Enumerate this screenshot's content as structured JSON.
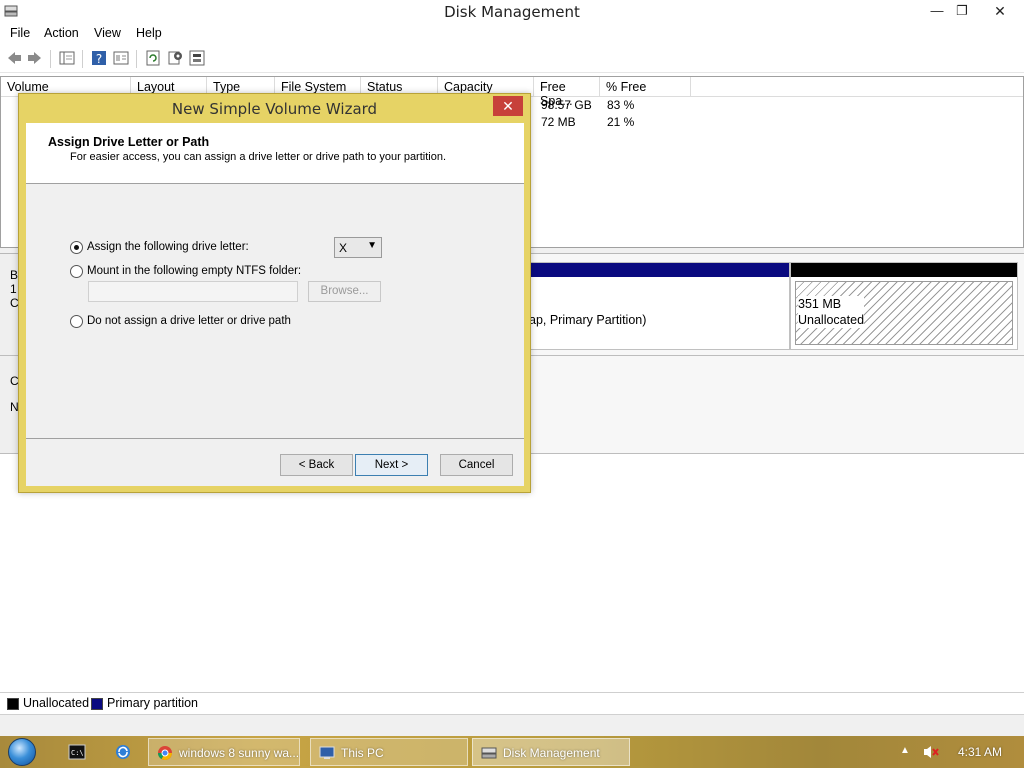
{
  "window": {
    "title": "Disk Management",
    "minimize_glyph": "—",
    "maximize_glyph": "❐",
    "close_glyph": "✕"
  },
  "menubar": {
    "items": [
      "File",
      "Action",
      "View",
      "Help"
    ]
  },
  "toolbar": {
    "icons": [
      "back-icon",
      "forward-icon",
      "console-tree-icon",
      "help-icon",
      "properties-icon",
      "refresh-icon",
      "settings-icon",
      "disk-properties-icon"
    ]
  },
  "volume_list": {
    "columns": [
      "Volume",
      "Layout",
      "Type",
      "File System",
      "Status",
      "Capacity",
      "Free Spa...",
      "% Free"
    ],
    "rows": [
      {
        "free": "98.57 GB",
        "pct": "83 %"
      },
      {
        "free": "72 MB",
        "pct": "21 %"
      }
    ]
  },
  "disk_view": {
    "disk0_label_fragments": [
      "B",
      "1",
      "C"
    ],
    "disk1_label_fragments": [
      "C",
      "N"
    ],
    "primary_partition_text": "ap, Primary Partition)",
    "unallocated_size": "351 MB",
    "unallocated_label": "Unallocated"
  },
  "legend": {
    "unallocated": "Unallocated",
    "primary": "Primary partition"
  },
  "colors": {
    "primary_partition": "#0a0a80",
    "unallocated": "#000000",
    "dialog_frame": "#e6d365",
    "dialog_close": "#c7413a"
  },
  "wizard": {
    "title": "New Simple Volume Wizard",
    "close_glyph": "✕",
    "header_title": "Assign Drive Letter or Path",
    "header_subtitle": "For easier access, you can assign a drive letter or drive path to your partition.",
    "option_assign": "Assign the following drive letter:",
    "drive_letter": "X",
    "option_mount": "Mount in the following empty NTFS folder:",
    "folder_value": "",
    "browse_label": "Browse...",
    "option_none": "Do not assign a drive letter or drive path",
    "back_label": "< Back",
    "next_label": "Next >",
    "cancel_label": "Cancel"
  },
  "taskbar": {
    "tasks": [
      "windows 8 sunny wa...",
      "This PC",
      "Disk Management"
    ],
    "clock": "4:31 AM"
  }
}
